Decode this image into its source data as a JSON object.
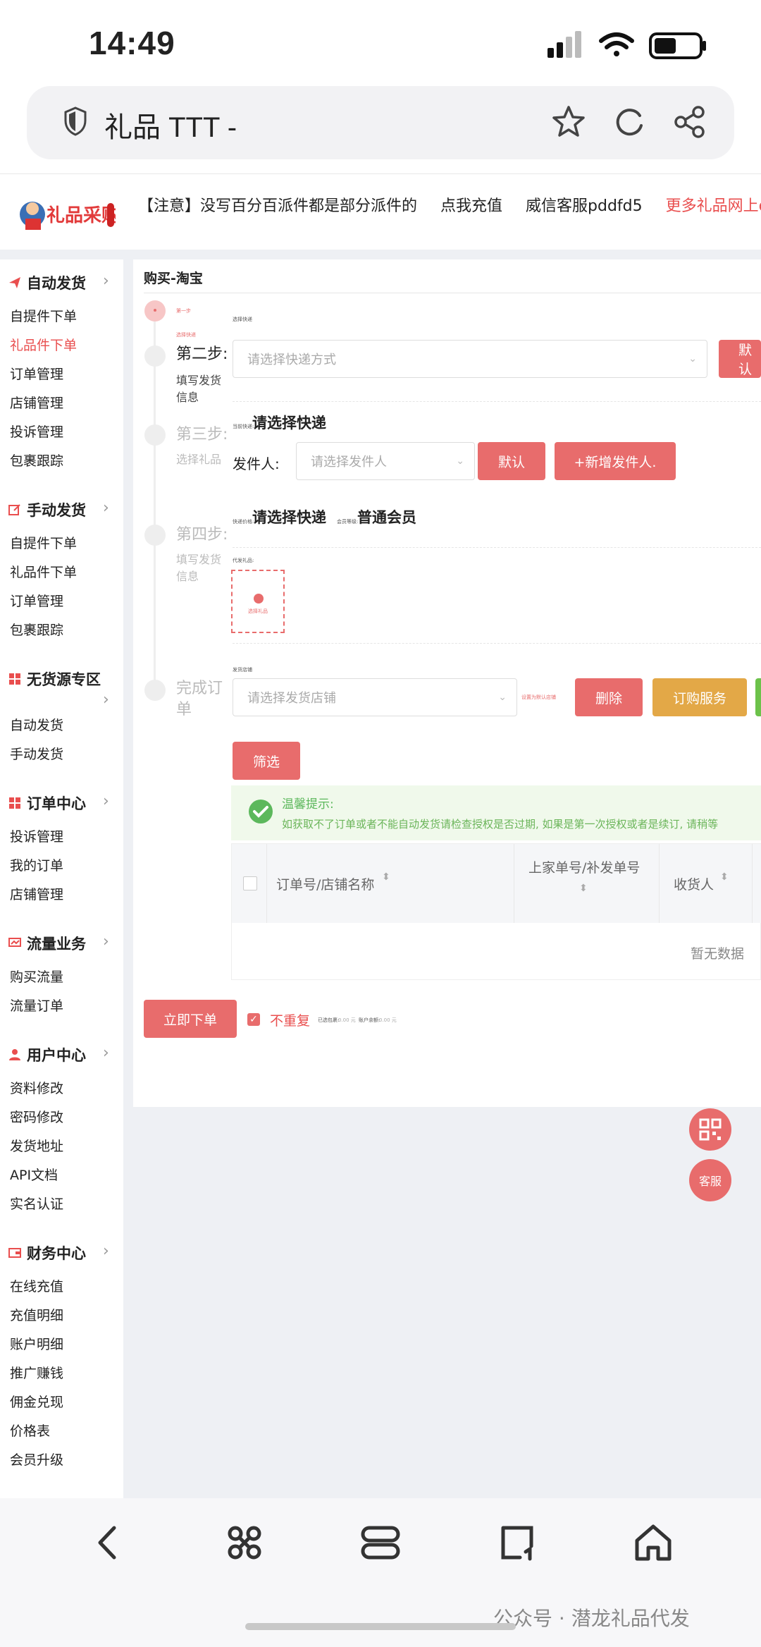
{
  "status_bar": {
    "time": "14:49"
  },
  "browser": {
    "title": "礼品 TTT -"
  },
  "header": {
    "logo_text": "礼品采购",
    "notices": [
      "【注意】没写百分百派件都是部分派件的",
      "点我充值",
      "威信客服pddfd5",
      "更多礼品网上qlaa"
    ]
  },
  "sidebar": {
    "sections": [
      {
        "title": "自动发货",
        "items": [
          "自提件下单",
          "礼品件下单",
          "订单管理",
          "店铺管理",
          "投诉管理",
          "包裹跟踪"
        ]
      },
      {
        "title": "手动发货",
        "items": [
          "自提件下单",
          "礼品件下单",
          "订单管理",
          "包裹跟踪"
        ]
      },
      {
        "title": "无货源专区",
        "items": [
          "自动发货",
          "手动发货"
        ]
      },
      {
        "title": "订单中心",
        "items": [
          "投诉管理",
          "我的订单",
          "店铺管理"
        ]
      },
      {
        "title": "流量业务",
        "items": [
          "购买流量",
          "流量订单"
        ]
      },
      {
        "title": "用户中心",
        "items": [
          "资料修改",
          "密码修改",
          "发货地址",
          "API文档",
          "实名认证"
        ]
      },
      {
        "title": "财务中心",
        "items": [
          "在线充值",
          "充值明细",
          "账户明细",
          "推广赚钱",
          "佣金兑现",
          "价格表",
          "会员升级"
        ]
      }
    ]
  },
  "main": {
    "breadcrumb": "购买-淘宝",
    "steps": [
      {
        "label": "",
        "sub": ""
      },
      {
        "label": "第二步:",
        "sub": "填写发货信息"
      },
      {
        "label": "第三步:",
        "sub": "选择礼品"
      },
      {
        "label": "第四步:",
        "sub": "填写发货信息"
      },
      {
        "label": "完成订单",
        "sub": ""
      }
    ],
    "step1_tiny": "第一步",
    "step1_tiny2": "选择快递",
    "express_tiny": "选择快递",
    "express_select_placeholder": "请选择快递方式",
    "express_default_btn": "默认",
    "current_express_tiny": "当前快递:",
    "current_express": "请选择快递",
    "sender_label": "发件人:",
    "sender_placeholder": "请选择发件人",
    "sender_default_btn": "默认",
    "add_sender_btn": "+新增发件人.",
    "price_express_tiny": "快递价格:",
    "price_express": "请选择快递",
    "member_tiny": "会员等级:",
    "member_level": "普通会员",
    "gift_tiny": "代发礼品:",
    "upload_label": "选择礼品",
    "shop_tiny": "发货店铺",
    "shop_placeholder": "请选择发货店铺",
    "shop_note_tiny": "设置为默认店铺",
    "delete_btn": "删除",
    "subscribe_btn": "订购服务",
    "filter_btn": "筛选",
    "tip_title": "温馨提示:",
    "tip_text": "如获取不了订单或者不能自动发货请检查授权是否过期, 如果是第一次授权或者是续订, 请稍等",
    "table_headers": [
      "订单号/店铺名称",
      "上家单号/补发单号",
      "收货人"
    ],
    "empty_text": "暂无数据",
    "submit_btn": "立即下单",
    "no_repeat": "不重复",
    "summary_tiny": [
      "已选包裹:",
      "0.00 元",
      "账户余额:",
      "0.00 元"
    ],
    "fab_service": "客服"
  },
  "watermark": "公众号 · 潜龙礼品代发",
  "colors": {
    "accent": "#e86c6c",
    "orange": "#e3a847",
    "green": "#6cc24a",
    "tip_bg": "#f0f9eb"
  }
}
